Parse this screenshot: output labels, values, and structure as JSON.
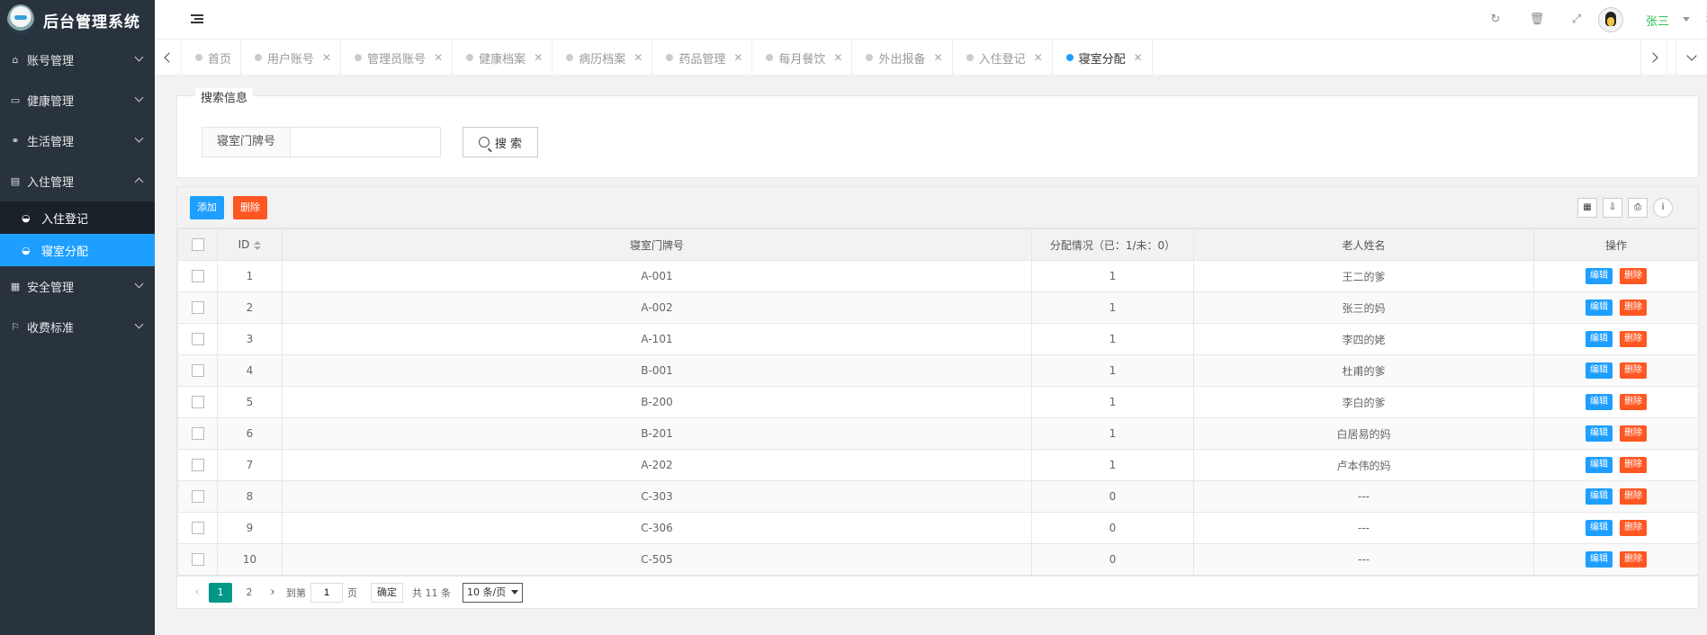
{
  "app": {
    "title": "后台管理系统"
  },
  "sidebar": {
    "items": [
      {
        "label": "账号管理",
        "icon": "home-icon",
        "expanded": false
      },
      {
        "label": "健康管理",
        "icon": "card-icon",
        "expanded": false
      },
      {
        "label": "生活管理",
        "icon": "share-icon",
        "expanded": false
      },
      {
        "label": "入住管理",
        "icon": "file-icon",
        "expanded": true,
        "children": [
          {
            "label": "入住登记",
            "icon": "dashboard-icon",
            "active": false
          },
          {
            "label": "寝室分配",
            "icon": "dashboard-icon",
            "active": true
          }
        ]
      },
      {
        "label": "安全管理",
        "icon": "calendar-icon",
        "expanded": false
      },
      {
        "label": "收费标准",
        "icon": "flag-icon",
        "expanded": false
      }
    ]
  },
  "header": {
    "user": "张三"
  },
  "tabs": [
    {
      "label": "首页",
      "active": false,
      "closable": false
    },
    {
      "label": "用户账号",
      "active": false,
      "closable": true
    },
    {
      "label": "管理员账号",
      "active": false,
      "closable": true
    },
    {
      "label": "健康档案",
      "active": false,
      "closable": true
    },
    {
      "label": "病历档案",
      "active": false,
      "closable": true
    },
    {
      "label": "药品管理",
      "active": false,
      "closable": true
    },
    {
      "label": "每月餐饮",
      "active": false,
      "closable": true
    },
    {
      "label": "外出报备",
      "active": false,
      "closable": true
    },
    {
      "label": "入住登记",
      "active": false,
      "closable": true
    },
    {
      "label": "寝室分配",
      "active": true,
      "closable": true
    }
  ],
  "search": {
    "legend": "搜索信息",
    "field_label": "寝室门牌号",
    "field_value": "",
    "button_label": "搜 索"
  },
  "toolbar": {
    "add_label": "添加",
    "delete_label": "删除"
  },
  "table": {
    "columns": [
      "ID",
      "寝室门牌号",
      "分配情况（已：1/未：0）",
      "老人姓名",
      "操作"
    ],
    "rows": [
      {
        "id": "1",
        "room": "A-001",
        "status": "1",
        "name": "王二的爹"
      },
      {
        "id": "2",
        "room": "A-002",
        "status": "1",
        "name": "张三的妈"
      },
      {
        "id": "3",
        "room": "A-101",
        "status": "1",
        "name": "李四的姥"
      },
      {
        "id": "4",
        "room": "B-001",
        "status": "1",
        "name": "杜甫的爹"
      },
      {
        "id": "5",
        "room": "B-200",
        "status": "1",
        "name": "李白的爹"
      },
      {
        "id": "6",
        "room": "B-201",
        "status": "1",
        "name": "白居易的妈"
      },
      {
        "id": "7",
        "room": "A-202",
        "status": "1",
        "name": "卢本伟的妈"
      },
      {
        "id": "8",
        "room": "C-303",
        "status": "0",
        "name": "---"
      },
      {
        "id": "9",
        "room": "C-306",
        "status": "0",
        "name": "---"
      },
      {
        "id": "10",
        "room": "C-505",
        "status": "0",
        "name": "---"
      }
    ],
    "edit_label": "编辑",
    "delete_label": "删除"
  },
  "pager": {
    "pages": [
      "1",
      "2"
    ],
    "current": "1",
    "goto_label": "到第",
    "goto_value": "1",
    "page_unit": "页",
    "confirm_label": "确定",
    "total_label": "共 11 条",
    "page_size": "10 条/页"
  },
  "colors": {
    "sidebar": "#28333e",
    "accent": "#1e9fff",
    "danger": "#ff5722",
    "pager_active": "#009688",
    "username": "#2bc253"
  }
}
